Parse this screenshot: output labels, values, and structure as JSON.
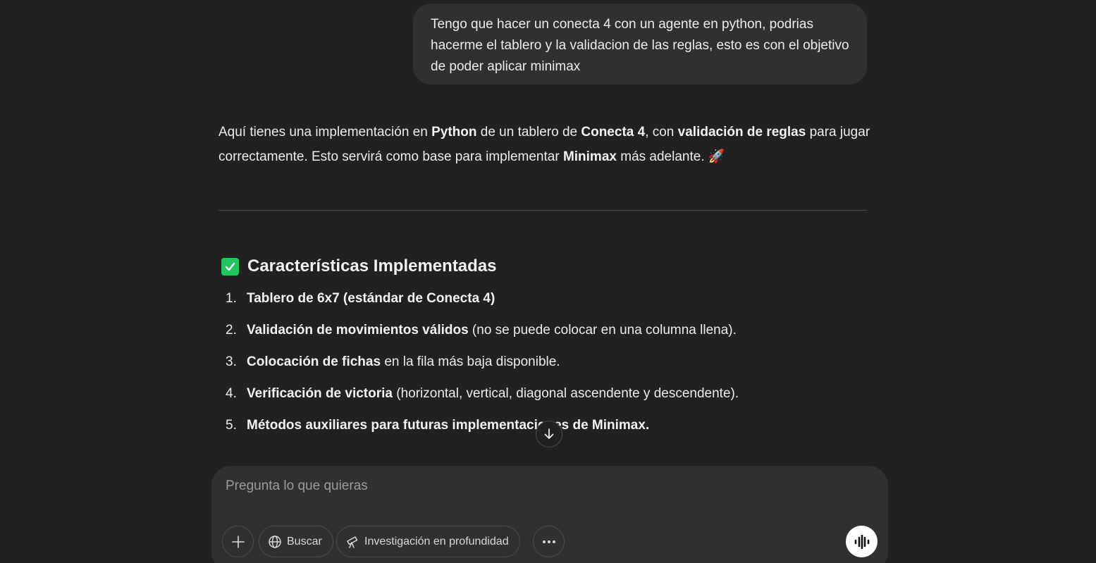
{
  "user_message": {
    "text": "Tengo que hacer un conecta 4 con un agente en python, podrias hacerme el tablero y la validacion de las reglas, esto es con el objetivo de poder aplicar minimax"
  },
  "assistant": {
    "intro": {
      "t1": "Aquí tienes una implementación en ",
      "b1": "Python",
      "t2": " de un tablero de ",
      "b2": "Conecta 4",
      "t3": ", con ",
      "b3": "validación de reglas",
      "t4": " para jugar correctamente. Esto servirá como base para implementar ",
      "b4": "Minimax",
      "t5": " más adelante. 🚀"
    },
    "section_title": "Características Implementadas",
    "features": [
      {
        "num": "1.",
        "bold": "Tablero de 6x7 (estándar de Conecta 4)",
        "rest": ""
      },
      {
        "num": "2.",
        "bold": "Validación de movimientos válidos",
        "rest": " (no se puede colocar en una columna llena)."
      },
      {
        "num": "3.",
        "bold": "Colocación de fichas",
        "rest": " en la fila más baja disponible."
      },
      {
        "num": "4.",
        "bold": "Verificación de victoria",
        "rest": " (horizontal, vertical, diagonal ascendente y descendente)."
      },
      {
        "num": "5.",
        "bold": "Métodos auxiliares para futuras implementaciones de Minimax.",
        "rest": ""
      }
    ]
  },
  "composer": {
    "placeholder": "Pregunta lo que quieras",
    "search_label": "Buscar",
    "deep_research_label": "Investigación en profundidad"
  },
  "icons": {
    "check": "check-icon",
    "scroll": "arrow-down-icon",
    "plus": "plus-icon",
    "globe": "globe-icon",
    "telescope": "telescope-icon",
    "more": "ellipsis-icon",
    "voice": "voice-wave-icon"
  },
  "colors": {
    "background": "#212121",
    "bubble": "#303030",
    "accent_check": "#22c55e"
  }
}
